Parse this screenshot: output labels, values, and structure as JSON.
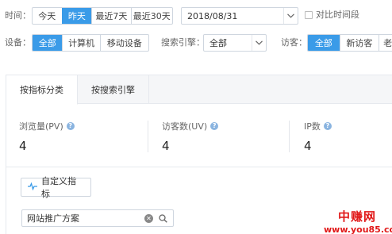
{
  "filters": {
    "time_label": "时间：",
    "time_buttons": [
      "今天",
      "昨天",
      "最近7天",
      "最近30天"
    ],
    "time_active": "昨天",
    "date_value": "2018/08/31",
    "compare_label": "对比时间段",
    "device_label": "设备：",
    "device_buttons": [
      "全部",
      "计算机",
      "移动设备"
    ],
    "device_active": "全部",
    "engine_label": "搜索引擎：",
    "engine_value": "全部",
    "visitor_label": "访客：",
    "visitor_buttons": [
      "全部",
      "新访客",
      "老"
    ],
    "visitor_active": "全部"
  },
  "tabs": [
    {
      "label": "按指标分类",
      "active": true
    },
    {
      "label": "按搜索引擎",
      "active": false
    }
  ],
  "metrics": [
    {
      "name": "浏览量(PV)",
      "value": "4"
    },
    {
      "name": "访客数(UV)",
      "value": "4"
    },
    {
      "name": "IP数",
      "value": "4"
    }
  ],
  "custom_metric_button": "自定义指标",
  "search": {
    "value": "网站推广方案"
  },
  "watermark": {
    "line1": "中赚网",
    "line2": "www.you85.com"
  },
  "colors": {
    "accent": "#3a9be8",
    "watermark": "#e11818"
  }
}
